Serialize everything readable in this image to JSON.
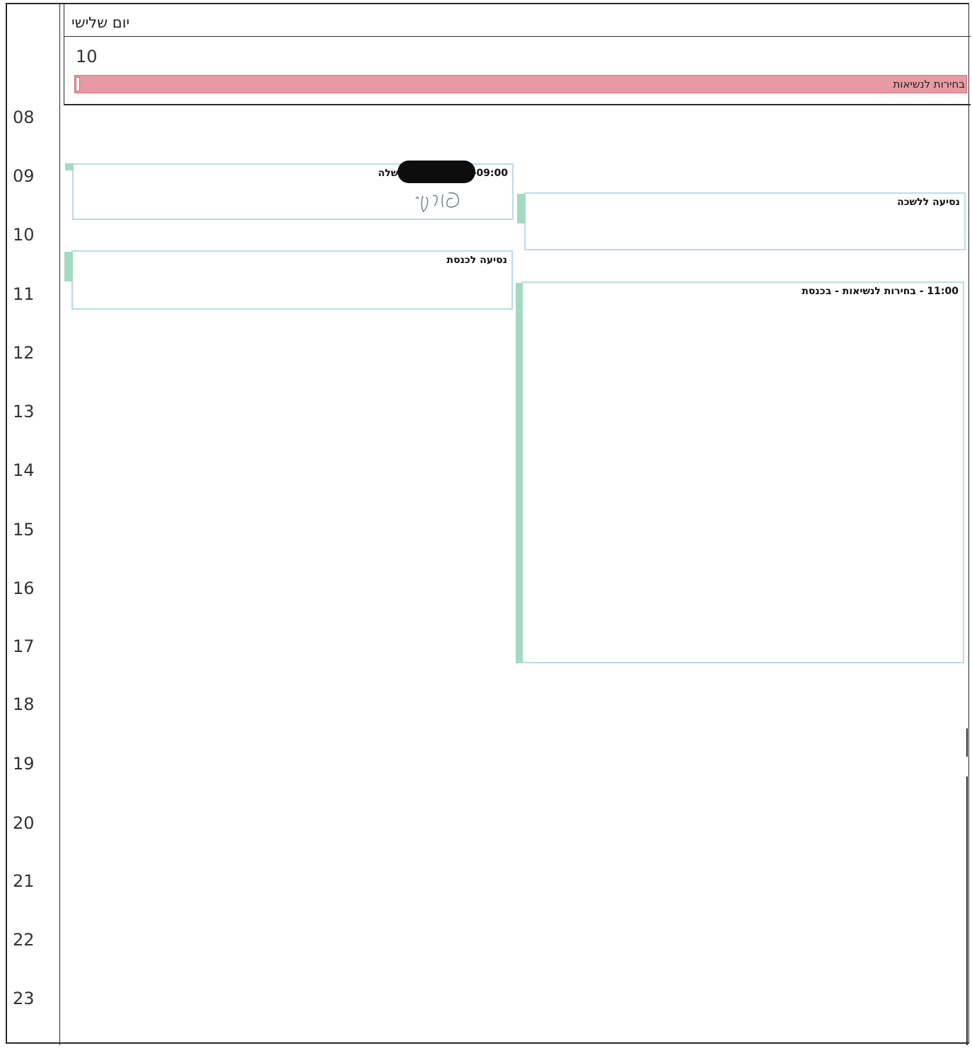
{
  "calendar": {
    "day_name": "יום שלישי",
    "date_number": "10",
    "all_day_event": "בחירות לנשיאות",
    "hours": [
      "08",
      "09",
      "10",
      "11",
      "12",
      "13",
      "14",
      "15",
      "16",
      "17",
      "18",
      "19",
      "20",
      "21",
      "22",
      "23"
    ],
    "events": [
      {
        "title": "09:00-           בבית ראש הממשלה"
      },
      {
        "title": "נסיעה ללשכה"
      },
      {
        "title": "נסיעה לכנסת"
      },
      {
        "title": "11:00 - בחירות לנשיאות - בכנסת"
      }
    ]
  },
  "colors": {
    "all_day_bg": "#e79aa3",
    "event_border": "#b9dde6",
    "event_stripe": "#a4d9c4",
    "redaction": "#0d0d0d"
  }
}
